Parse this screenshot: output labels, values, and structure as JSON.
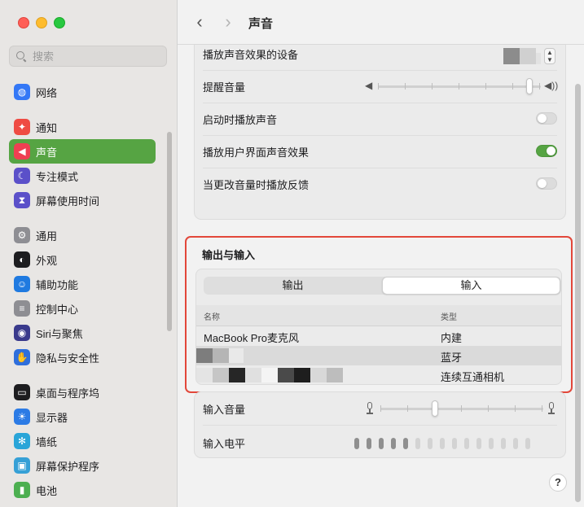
{
  "window": {
    "title": "声音"
  },
  "sidebar": {
    "search_placeholder": "搜索",
    "items": [
      {
        "label": "网络",
        "icon": "globe-icon",
        "color": "#3478f6"
      },
      {
        "label": "通知",
        "icon": "bell-icon",
        "color": "#ef4b43"
      },
      {
        "label": "声音",
        "icon": "speaker-icon",
        "color": "#ee3f52",
        "active": true
      },
      {
        "label": "专注模式",
        "icon": "moon-icon",
        "color": "#5b50c9"
      },
      {
        "label": "屏幕使用时间",
        "icon": "hourglass-icon",
        "color": "#5b50c9"
      },
      {
        "label": "通用",
        "icon": "gear-icon",
        "color": "#8e8e93"
      },
      {
        "label": "外观",
        "icon": "appearance-icon",
        "color": "#1d1d1f"
      },
      {
        "label": "辅助功能",
        "icon": "accessibility-icon",
        "color": "#1f7ae0"
      },
      {
        "label": "控制中心",
        "icon": "control-center-icon",
        "color": "#8e8e93"
      },
      {
        "label": "Siri与聚焦",
        "icon": "siri-icon",
        "color": "#3a3a8c"
      },
      {
        "label": "隐私与安全性",
        "icon": "hand-icon",
        "color": "#2f6fdc"
      },
      {
        "label": "桌面与程序坞",
        "icon": "dock-icon",
        "color": "#1d1d1f"
      },
      {
        "label": "显示器",
        "icon": "sun-icon",
        "color": "#2c7be5"
      },
      {
        "label": "墙纸",
        "icon": "snowflake-icon",
        "color": "#2aa5d8"
      },
      {
        "label": "屏幕保护程序",
        "icon": "screensaver-icon",
        "color": "#36a0d6"
      },
      {
        "label": "电池",
        "icon": "battery-icon",
        "color": "#4caf50"
      }
    ]
  },
  "toolbar": {
    "back_glyph": "‹",
    "forward_glyph": "›"
  },
  "sound_effects": {
    "device_label": "播放声音效果的设备",
    "alert_volume_label": "提醒音量",
    "alert_volume_level": 0.95,
    "startup_sound_label": "启动时播放声音",
    "startup_sound_on": false,
    "ui_effects_label": "播放用户界面声音效果",
    "ui_effects_on": true,
    "volume_feedback_label": "当更改音量时播放反馈",
    "volume_feedback_on": false
  },
  "io": {
    "section_title": "输出与输入",
    "tabs": {
      "output": "输出",
      "input": "输入",
      "selected": "input"
    },
    "columns": {
      "name": "名称",
      "type": "类型"
    },
    "devices": [
      {
        "name": "MacBook Pro麦克风",
        "type": "内建"
      },
      {
        "name": "",
        "type": "蓝牙"
      },
      {
        "name": "",
        "type": "连续互通相机"
      }
    ]
  },
  "input": {
    "volume_label": "输入音量",
    "volume_level": 0.33,
    "level_label": "输入电平",
    "level_lit_segments": 5,
    "level_total_segments": 15
  },
  "help": {
    "glyph": "?"
  },
  "colors": {
    "accent_green": "#56a443",
    "highlight_red": "#e2473a"
  }
}
